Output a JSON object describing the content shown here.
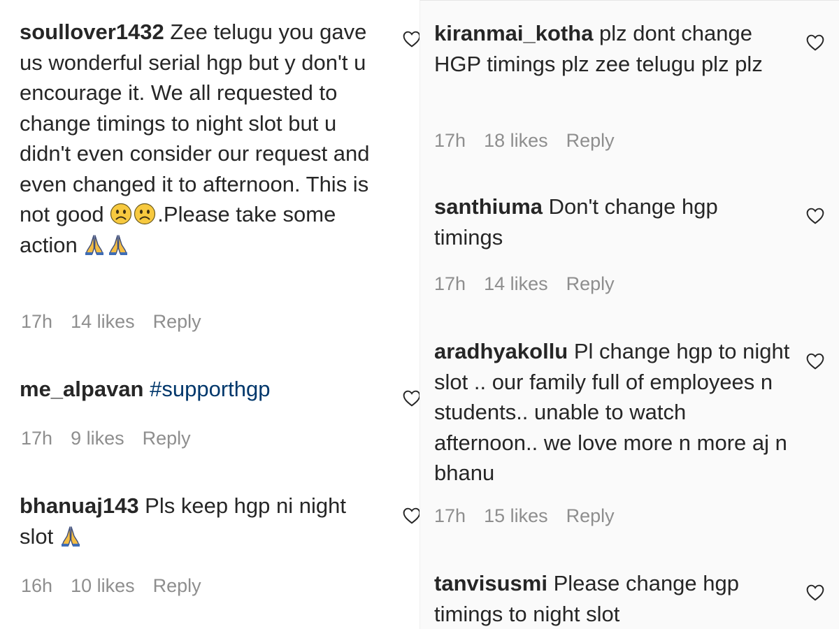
{
  "left_column": [
    {
      "username": "soullover1432",
      "text_before_emojis": " Zee telugu you gave us wonderful serial hgp but y don't u encourage it. We all requested to change timings to night slot but u didn't even consider our request and even changed it to afternoon. This is not good ",
      "text_mid": ".Please take some action ",
      "emojis_sad": [
        "sad-face",
        "sad-face"
      ],
      "emojis_pray": [
        "folded-hands",
        "folded-hands"
      ],
      "time": "17h",
      "likes": "14 likes",
      "reply": "Reply"
    },
    {
      "username": "me_alpavan",
      "hashtag": "#supporthgp",
      "time": "17h",
      "likes": "9 likes",
      "reply": "Reply"
    },
    {
      "username": "bhanuaj143",
      "text": " Pls keep hgp ni night slot ",
      "emojis_pray": [
        "folded-hands"
      ],
      "time": "16h",
      "likes": "10 likes",
      "reply": "Reply"
    }
  ],
  "right_column": [
    {
      "username": "kiranmai_kotha",
      "text": " plz dont change HGP timings plz zee telugu plz plz",
      "time": "17h",
      "likes": "18 likes",
      "reply": "Reply"
    },
    {
      "username": "santhiuma",
      "text": " Don't change hgp timings",
      "time": "17h",
      "likes": "14 likes",
      "reply": "Reply"
    },
    {
      "username": "aradhyakollu",
      "text": " Pl change hgp to night slot .. our family full of employees n students.. unable to watch afternoon.. we love more n more aj n bhanu",
      "time": "17h",
      "likes": "15 likes",
      "reply": "Reply"
    },
    {
      "username": "tanvisusmi",
      "text": " Please change hgp timings to night slot"
    }
  ],
  "icons": {
    "like": "heart-outline-icon",
    "sad": "sad-face-emoji",
    "pray": "folded-hands-emoji"
  },
  "colors": {
    "text": "#262626",
    "meta": "#8e8e8e",
    "hashtag": "#00376b",
    "right_bg": "#fafafa"
  }
}
